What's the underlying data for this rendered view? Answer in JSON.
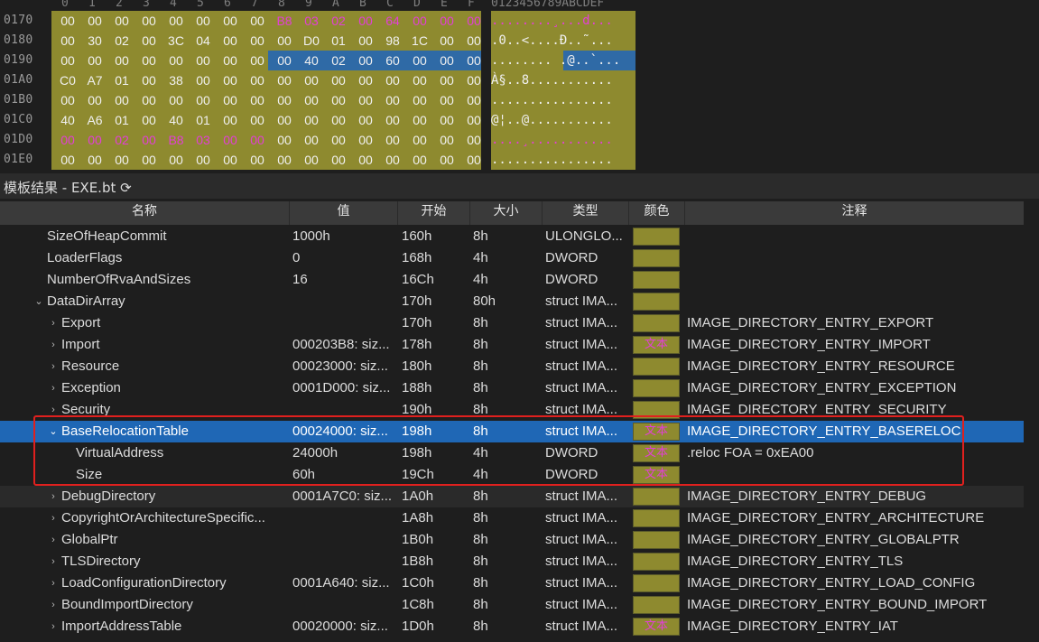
{
  "hex_view": {
    "col_headers": [
      "0",
      "1",
      "2",
      "3",
      "4",
      "5",
      "6",
      "7",
      "8",
      "9",
      "A",
      "B",
      "C",
      "D",
      "E",
      "F"
    ],
    "ascii_header": "0123456789ABCDEF",
    "rows": [
      {
        "addr": "0170",
        "bytes": [
          "00",
          "00",
          "00",
          "00",
          "00",
          "00",
          "00",
          "00",
          "B8",
          "03",
          "02",
          "00",
          "64",
          "00",
          "00",
          "00"
        ],
        "ascii": "........¸...d...",
        "hl": [
          8,
          9,
          10,
          11,
          12,
          13,
          14,
          15
        ]
      },
      {
        "addr": "0180",
        "bytes": [
          "00",
          "30",
          "02",
          "00",
          "3C",
          "04",
          "00",
          "00",
          "00",
          "D0",
          "01",
          "00",
          "98",
          "1C",
          "00",
          "00"
        ],
        "ascii": ".0..<....Ð..˜...",
        "hl": []
      },
      {
        "addr": "0190",
        "bytes": [
          "00",
          "00",
          "00",
          "00",
          "00",
          "00",
          "00",
          "00",
          "00",
          "40",
          "02",
          "00",
          "60",
          "00",
          "00",
          "00"
        ],
        "ascii": "........ .@..`...",
        "hl": [],
        "sel": true
      },
      {
        "addr": "01A0",
        "bytes": [
          "C0",
          "A7",
          "01",
          "00",
          "38",
          "00",
          "00",
          "00",
          "00",
          "00",
          "00",
          "00",
          "00",
          "00",
          "00",
          "00"
        ],
        "ascii": "À§..8...........",
        "hl": []
      },
      {
        "addr": "01B0",
        "bytes": [
          "00",
          "00",
          "00",
          "00",
          "00",
          "00",
          "00",
          "00",
          "00",
          "00",
          "00",
          "00",
          "00",
          "00",
          "00",
          "00"
        ],
        "ascii": "................",
        "hl": []
      },
      {
        "addr": "01C0",
        "bytes": [
          "40",
          "A6",
          "01",
          "00",
          "40",
          "01",
          "00",
          "00",
          "00",
          "00",
          "00",
          "00",
          "00",
          "00",
          "00",
          "00"
        ],
        "ascii": "@¦..@...........",
        "hl": []
      },
      {
        "addr": "01D0",
        "bytes": [
          "00",
          "00",
          "02",
          "00",
          "B8",
          "03",
          "00",
          "00",
          "00",
          "00",
          "00",
          "00",
          "00",
          "00",
          "00",
          "00"
        ],
        "ascii": "....¸...........",
        "hl": [
          0,
          1,
          2,
          3,
          4,
          5,
          6,
          7
        ]
      },
      {
        "addr": "01E0",
        "bytes": [
          "00",
          "00",
          "00",
          "00",
          "00",
          "00",
          "00",
          "00",
          "00",
          "00",
          "00",
          "00",
          "00",
          "00",
          "00",
          "00"
        ],
        "ascii": "................",
        "hl": []
      }
    ]
  },
  "panel": {
    "title": "模板结果 - EXE.bt ⟳"
  },
  "table": {
    "headers": {
      "name": "名称",
      "value": "值",
      "start": "开始",
      "size": "大小",
      "type": "类型",
      "color": "颜色",
      "comment": "注释"
    },
    "rows": [
      {
        "indent": 0,
        "chev": "",
        "name": "SizeOfHeapCommit",
        "value": "1000h",
        "start": "160h",
        "size": "8h",
        "type": "ULONGLO...",
        "text": "",
        "comment": ""
      },
      {
        "indent": 0,
        "chev": "",
        "name": "LoaderFlags",
        "value": "0",
        "start": "168h",
        "size": "4h",
        "type": "DWORD",
        "text": "",
        "comment": ""
      },
      {
        "indent": 0,
        "chev": "",
        "name": "NumberOfRvaAndSizes",
        "value": "16",
        "start": "16Ch",
        "size": "4h",
        "type": "DWORD",
        "text": "",
        "comment": ""
      },
      {
        "indent": 0,
        "chev": "⌄",
        "name": "DataDirArray",
        "value": "",
        "start": "170h",
        "size": "80h",
        "type": "struct IMA...",
        "text": "",
        "comment": ""
      },
      {
        "indent": 1,
        "chev": "›",
        "name": "Export",
        "value": "",
        "start": "170h",
        "size": "8h",
        "type": "struct IMA...",
        "text": "",
        "comment": "IMAGE_DIRECTORY_ENTRY_EXPORT"
      },
      {
        "indent": 1,
        "chev": "›",
        "name": "Import",
        "value": "000203B8: siz...",
        "start": "178h",
        "size": "8h",
        "type": "struct IMA...",
        "text": "文本",
        "comment": "IMAGE_DIRECTORY_ENTRY_IMPORT"
      },
      {
        "indent": 1,
        "chev": "›",
        "name": "Resource",
        "value": "00023000: siz...",
        "start": "180h",
        "size": "8h",
        "type": "struct IMA...",
        "text": "",
        "comment": "IMAGE_DIRECTORY_ENTRY_RESOURCE"
      },
      {
        "indent": 1,
        "chev": "›",
        "name": "Exception",
        "value": "0001D000: siz...",
        "start": "188h",
        "size": "8h",
        "type": "struct IMA...",
        "text": "",
        "comment": "IMAGE_DIRECTORY_ENTRY_EXCEPTION"
      },
      {
        "indent": 1,
        "chev": "›",
        "name": "Security",
        "value": "",
        "start": "190h",
        "size": "8h",
        "type": "struct IMA...",
        "text": "",
        "comment": "IMAGE_DIRECTORY_ENTRY_SECURITY"
      },
      {
        "indent": 1,
        "chev": "⌄",
        "name": "BaseRelocationTable",
        "value": "00024000: siz...",
        "start": "198h",
        "size": "8h",
        "type": "struct IMA...",
        "text": "文本",
        "comment": "IMAGE_DIRECTORY_ENTRY_BASERELOC",
        "selected": true
      },
      {
        "indent": 2,
        "chev": "",
        "name": "VirtualAddress",
        "value": "24000h",
        "start": "198h",
        "size": "4h",
        "type": "DWORD",
        "text": "文本",
        "comment": ".reloc FOA = 0xEA00"
      },
      {
        "indent": 2,
        "chev": "",
        "name": "Size",
        "value": "60h",
        "start": "19Ch",
        "size": "4h",
        "type": "DWORD",
        "text": "文本",
        "comment": ""
      },
      {
        "indent": 1,
        "chev": "›",
        "name": "DebugDirectory",
        "value": "0001A7C0: siz...",
        "start": "1A0h",
        "size": "8h",
        "type": "struct IMA...",
        "text": "",
        "comment": "IMAGE_DIRECTORY_ENTRY_DEBUG",
        "alt": true
      },
      {
        "indent": 1,
        "chev": "›",
        "name": "CopyrightOrArchitectureSpecific...",
        "value": "",
        "start": "1A8h",
        "size": "8h",
        "type": "struct IMA...",
        "text": "",
        "comment": "IMAGE_DIRECTORY_ENTRY_ARCHITECTURE"
      },
      {
        "indent": 1,
        "chev": "›",
        "name": "GlobalPtr",
        "value": "",
        "start": "1B0h",
        "size": "8h",
        "type": "struct IMA...",
        "text": "",
        "comment": "IMAGE_DIRECTORY_ENTRY_GLOBALPTR"
      },
      {
        "indent": 1,
        "chev": "›",
        "name": "TLSDirectory",
        "value": "",
        "start": "1B8h",
        "size": "8h",
        "type": "struct IMA...",
        "text": "",
        "comment": "IMAGE_DIRECTORY_ENTRY_TLS"
      },
      {
        "indent": 1,
        "chev": "›",
        "name": "LoadConfigurationDirectory",
        "value": "0001A640: siz...",
        "start": "1C0h",
        "size": "8h",
        "type": "struct IMA...",
        "text": "",
        "comment": "IMAGE_DIRECTORY_ENTRY_LOAD_CONFIG"
      },
      {
        "indent": 1,
        "chev": "›",
        "name": "BoundImportDirectory",
        "value": "",
        "start": "1C8h",
        "size": "8h",
        "type": "struct IMA...",
        "text": "",
        "comment": "IMAGE_DIRECTORY_ENTRY_BOUND_IMPORT"
      },
      {
        "indent": 1,
        "chev": "›",
        "name": "ImportAddressTable",
        "value": "00020000: siz...",
        "start": "1D0h",
        "size": "8h",
        "type": "struct IMA...",
        "text": "文本",
        "comment": "IMAGE_DIRECTORY_ENTRY_IAT"
      }
    ]
  }
}
